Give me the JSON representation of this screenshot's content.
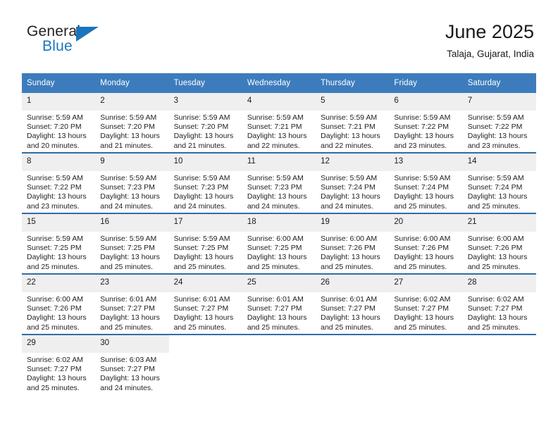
{
  "brand": {
    "name_line1": "General",
    "name_line2": "Blue",
    "accent_color": "#1b75bc"
  },
  "header": {
    "title": "June 2025",
    "location": "Talaja, Gujarat, India"
  },
  "theme": {
    "header_row_bg": "#3c7cbd",
    "week_divider": "#2e6da8",
    "date_band_bg": "#efefef",
    "text": "#1a1a1a"
  },
  "weekday_headers": [
    "Sunday",
    "Monday",
    "Tuesday",
    "Wednesday",
    "Thursday",
    "Friday",
    "Saturday"
  ],
  "weeks": [
    [
      {
        "day": "1",
        "sunrise": "Sunrise: 5:59 AM",
        "sunset": "Sunset: 7:20 PM",
        "daylight1": "Daylight: 13 hours",
        "daylight2": "and 20 minutes."
      },
      {
        "day": "2",
        "sunrise": "Sunrise: 5:59 AM",
        "sunset": "Sunset: 7:20 PM",
        "daylight1": "Daylight: 13 hours",
        "daylight2": "and 21 minutes."
      },
      {
        "day": "3",
        "sunrise": "Sunrise: 5:59 AM",
        "sunset": "Sunset: 7:20 PM",
        "daylight1": "Daylight: 13 hours",
        "daylight2": "and 21 minutes."
      },
      {
        "day": "4",
        "sunrise": "Sunrise: 5:59 AM",
        "sunset": "Sunset: 7:21 PM",
        "daylight1": "Daylight: 13 hours",
        "daylight2": "and 22 minutes."
      },
      {
        "day": "5",
        "sunrise": "Sunrise: 5:59 AM",
        "sunset": "Sunset: 7:21 PM",
        "daylight1": "Daylight: 13 hours",
        "daylight2": "and 22 minutes."
      },
      {
        "day": "6",
        "sunrise": "Sunrise: 5:59 AM",
        "sunset": "Sunset: 7:22 PM",
        "daylight1": "Daylight: 13 hours",
        "daylight2": "and 23 minutes."
      },
      {
        "day": "7",
        "sunrise": "Sunrise: 5:59 AM",
        "sunset": "Sunset: 7:22 PM",
        "daylight1": "Daylight: 13 hours",
        "daylight2": "and 23 minutes."
      }
    ],
    [
      {
        "day": "8",
        "sunrise": "Sunrise: 5:59 AM",
        "sunset": "Sunset: 7:22 PM",
        "daylight1": "Daylight: 13 hours",
        "daylight2": "and 23 minutes."
      },
      {
        "day": "9",
        "sunrise": "Sunrise: 5:59 AM",
        "sunset": "Sunset: 7:23 PM",
        "daylight1": "Daylight: 13 hours",
        "daylight2": "and 24 minutes."
      },
      {
        "day": "10",
        "sunrise": "Sunrise: 5:59 AM",
        "sunset": "Sunset: 7:23 PM",
        "daylight1": "Daylight: 13 hours",
        "daylight2": "and 24 minutes."
      },
      {
        "day": "11",
        "sunrise": "Sunrise: 5:59 AM",
        "sunset": "Sunset: 7:23 PM",
        "daylight1": "Daylight: 13 hours",
        "daylight2": "and 24 minutes."
      },
      {
        "day": "12",
        "sunrise": "Sunrise: 5:59 AM",
        "sunset": "Sunset: 7:24 PM",
        "daylight1": "Daylight: 13 hours",
        "daylight2": "and 24 minutes."
      },
      {
        "day": "13",
        "sunrise": "Sunrise: 5:59 AM",
        "sunset": "Sunset: 7:24 PM",
        "daylight1": "Daylight: 13 hours",
        "daylight2": "and 25 minutes."
      },
      {
        "day": "14",
        "sunrise": "Sunrise: 5:59 AM",
        "sunset": "Sunset: 7:24 PM",
        "daylight1": "Daylight: 13 hours",
        "daylight2": "and 25 minutes."
      }
    ],
    [
      {
        "day": "15",
        "sunrise": "Sunrise: 5:59 AM",
        "sunset": "Sunset: 7:25 PM",
        "daylight1": "Daylight: 13 hours",
        "daylight2": "and 25 minutes."
      },
      {
        "day": "16",
        "sunrise": "Sunrise: 5:59 AM",
        "sunset": "Sunset: 7:25 PM",
        "daylight1": "Daylight: 13 hours",
        "daylight2": "and 25 minutes."
      },
      {
        "day": "17",
        "sunrise": "Sunrise: 5:59 AM",
        "sunset": "Sunset: 7:25 PM",
        "daylight1": "Daylight: 13 hours",
        "daylight2": "and 25 minutes."
      },
      {
        "day": "18",
        "sunrise": "Sunrise: 6:00 AM",
        "sunset": "Sunset: 7:25 PM",
        "daylight1": "Daylight: 13 hours",
        "daylight2": "and 25 minutes."
      },
      {
        "day": "19",
        "sunrise": "Sunrise: 6:00 AM",
        "sunset": "Sunset: 7:26 PM",
        "daylight1": "Daylight: 13 hours",
        "daylight2": "and 25 minutes."
      },
      {
        "day": "20",
        "sunrise": "Sunrise: 6:00 AM",
        "sunset": "Sunset: 7:26 PM",
        "daylight1": "Daylight: 13 hours",
        "daylight2": "and 25 minutes."
      },
      {
        "day": "21",
        "sunrise": "Sunrise: 6:00 AM",
        "sunset": "Sunset: 7:26 PM",
        "daylight1": "Daylight: 13 hours",
        "daylight2": "and 25 minutes."
      }
    ],
    [
      {
        "day": "22",
        "sunrise": "Sunrise: 6:00 AM",
        "sunset": "Sunset: 7:26 PM",
        "daylight1": "Daylight: 13 hours",
        "daylight2": "and 25 minutes."
      },
      {
        "day": "23",
        "sunrise": "Sunrise: 6:01 AM",
        "sunset": "Sunset: 7:27 PM",
        "daylight1": "Daylight: 13 hours",
        "daylight2": "and 25 minutes."
      },
      {
        "day": "24",
        "sunrise": "Sunrise: 6:01 AM",
        "sunset": "Sunset: 7:27 PM",
        "daylight1": "Daylight: 13 hours",
        "daylight2": "and 25 minutes."
      },
      {
        "day": "25",
        "sunrise": "Sunrise: 6:01 AM",
        "sunset": "Sunset: 7:27 PM",
        "daylight1": "Daylight: 13 hours",
        "daylight2": "and 25 minutes."
      },
      {
        "day": "26",
        "sunrise": "Sunrise: 6:01 AM",
        "sunset": "Sunset: 7:27 PM",
        "daylight1": "Daylight: 13 hours",
        "daylight2": "and 25 minutes."
      },
      {
        "day": "27",
        "sunrise": "Sunrise: 6:02 AM",
        "sunset": "Sunset: 7:27 PM",
        "daylight1": "Daylight: 13 hours",
        "daylight2": "and 25 minutes."
      },
      {
        "day": "28",
        "sunrise": "Sunrise: 6:02 AM",
        "sunset": "Sunset: 7:27 PM",
        "daylight1": "Daylight: 13 hours",
        "daylight2": "and 25 minutes."
      }
    ],
    [
      {
        "day": "29",
        "sunrise": "Sunrise: 6:02 AM",
        "sunset": "Sunset: 7:27 PM",
        "daylight1": "Daylight: 13 hours",
        "daylight2": "and 25 minutes."
      },
      {
        "day": "30",
        "sunrise": "Sunrise: 6:03 AM",
        "sunset": "Sunset: 7:27 PM",
        "daylight1": "Daylight: 13 hours",
        "daylight2": "and 24 minutes."
      },
      {
        "day": "",
        "sunrise": "",
        "sunset": "",
        "daylight1": "",
        "daylight2": ""
      },
      {
        "day": "",
        "sunrise": "",
        "sunset": "",
        "daylight1": "",
        "daylight2": ""
      },
      {
        "day": "",
        "sunrise": "",
        "sunset": "",
        "daylight1": "",
        "daylight2": ""
      },
      {
        "day": "",
        "sunrise": "",
        "sunset": "",
        "daylight1": "",
        "daylight2": ""
      },
      {
        "day": "",
        "sunrise": "",
        "sunset": "",
        "daylight1": "",
        "daylight2": ""
      }
    ]
  ]
}
